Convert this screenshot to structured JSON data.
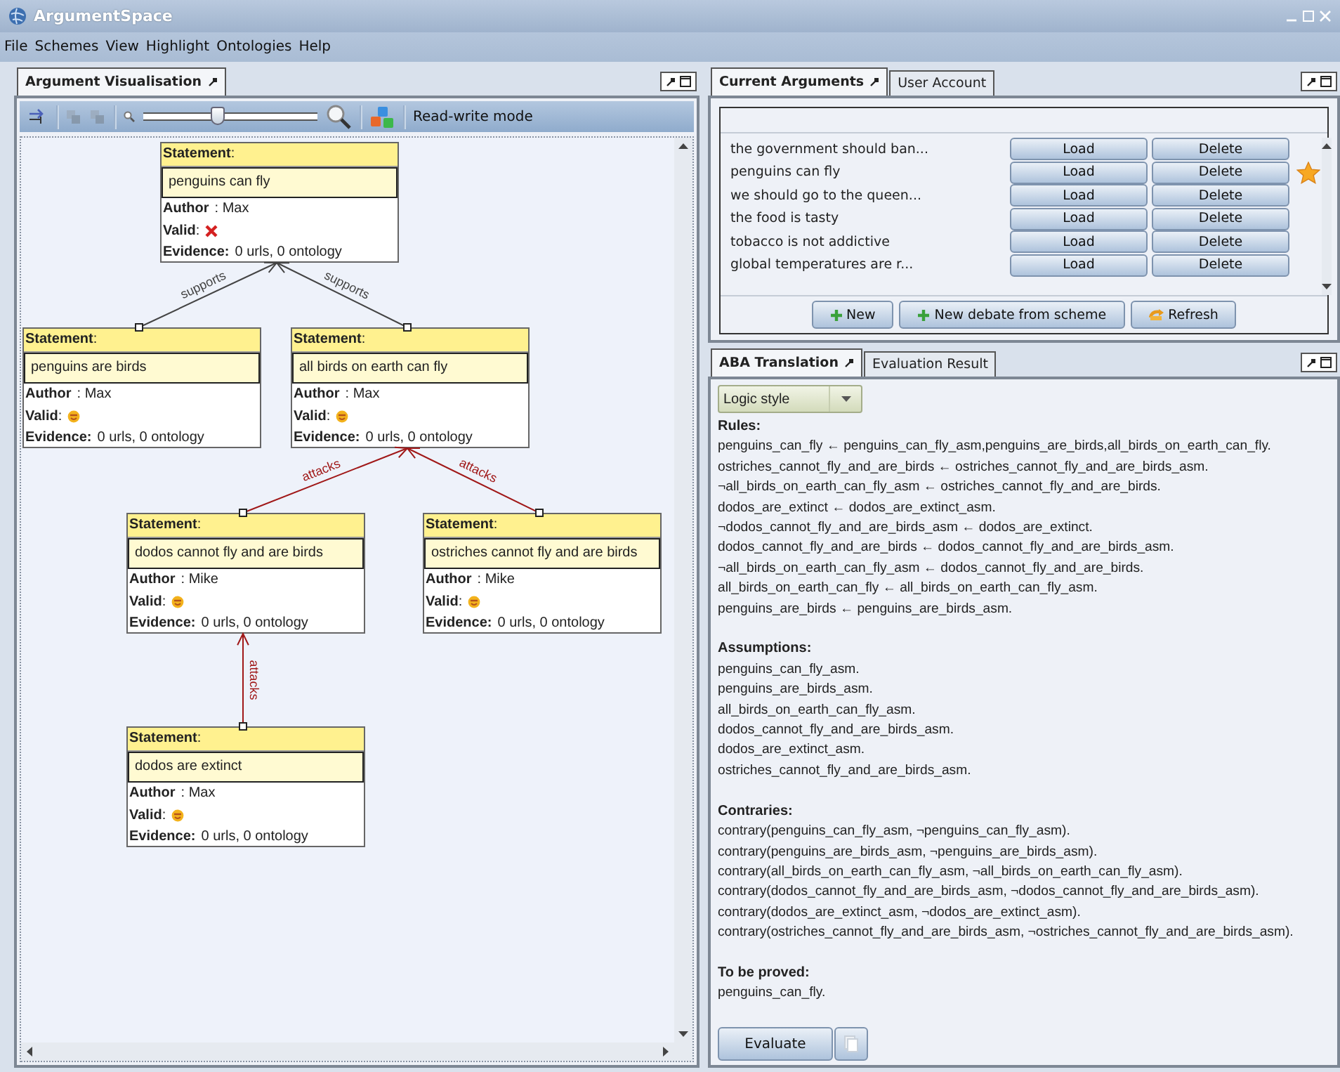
{
  "window": {
    "title": "ArgumentSpace"
  },
  "menu": [
    "File",
    "Schemes",
    "View",
    "Highlight",
    "Ontologies",
    "Help"
  ],
  "visualisation": {
    "tabs": [
      {
        "label": "Argument Visualisation",
        "selected": true
      }
    ],
    "toolbar": {
      "zoom": {
        "level": 0.43
      },
      "mode": "Read-write mode"
    },
    "argument": {
      "heading": "**Statement**:",
      "statement": "penguins can fly",
      "author": "**Author**: Max",
      "valid_label": "**Valid**:",
      "valid": false,
      "evidence": "**Evidence:** 0 urls, 0 ontology",
      "children": [
        {
          "relation": {
            "kind": "supports",
            "label": "supports"
          },
          "heading": "**Statement**:",
          "statement": "penguins are birds",
          "author": "**Author**: Max",
          "valid_label": "**Valid**:",
          "valid": true,
          "evidence": "**Evidence:** 0 urls, 0 ontology"
        },
        {
          "relation": {
            "kind": "supports",
            "label": "supports"
          },
          "heading": "**Statement**:",
          "statement": "all birds on earth can fly",
          "author": "**Author**: Max",
          "valid_label": "**Valid**:",
          "valid": true,
          "evidence": "**Evidence:** 0 urls, 0 ontology",
          "children": [
            {
              "relation": {
                "kind": "attacks",
                "label": "attacks"
              },
              "heading": "**Statement**:",
              "statement": "dodos cannot fly and are birds",
              "author": "**Author**: Mike",
              "valid_label": "**Valid**:",
              "valid": true,
              "evidence": "**Evidence:** 0 urls, 0 ontology",
              "children": [
                {
                  "relation": {
                    "kind": "attacks",
                    "label": "attacks"
                  },
                  "heading": "**Statement**:",
                  "statement": "dodos are extinct",
                  "author": "**Author**: Max",
                  "valid_label": "**Valid**:",
                  "valid": true,
                  "evidence": "**Evidence:** 0 urls, 0 ontology"
                }
              ]
            },
            {
              "relation": {
                "kind": "attacks",
                "label": "attacks"
              },
              "heading": "**Statement**:",
              "statement": "ostriches cannot fly and are birds",
              "author": "**Author**: Mike",
              "valid_label": "**Valid**:",
              "valid": true,
              "evidence": "**Evidence:** 0 urls, 0 ontology"
            }
          ]
        }
      ]
    }
  },
  "arguments": {
    "tabs": [
      {
        "label": "Current Arguments",
        "selected": true
      },
      {
        "label": "User Account",
        "selected": false
      }
    ],
    "rows": [
      {
        "title": "the government should ban...",
        "load": "Load",
        "delete": "Delete",
        "starred": false
      },
      {
        "title": "penguins can fly",
        "load": "Load",
        "delete": "Delete",
        "starred": true
      },
      {
        "title": "we should go to the queen...",
        "load": "Load",
        "delete": "Delete",
        "starred": false
      },
      {
        "title": "the food is tasty",
        "load": "Load",
        "delete": "Delete",
        "starred": false
      },
      {
        "title": "tobacco is not addictive",
        "load": "Load",
        "delete": "Delete",
        "starred": false
      },
      {
        "title": "global temperatures are r...",
        "load": "Load",
        "delete": "Delete",
        "starred": false
      }
    ],
    "actions": [
      {
        "label": "New",
        "kind": "add"
      },
      {
        "label": "New debate from scheme",
        "kind": "add"
      },
      {
        "label": "Refresh",
        "kind": "refresh"
      }
    ]
  },
  "aba": {
    "tabs": [
      {
        "label": "ABA Translation",
        "selected": true
      },
      {
        "label": "Evaluation Result",
        "selected": false
      }
    ],
    "style": "Logic style",
    "sections": [
      {
        "heading": "Rules:",
        "lines": [
          "penguins_can_fly ← penguins_can_fly_asm,penguins_are_birds,all_birds_on_earth_can_fly.",
          "ostriches_cannot_fly_and_are_birds ← ostriches_cannot_fly_and_are_birds_asm.",
          "¬all_birds_on_earth_can_fly_asm ← ostriches_cannot_fly_and_are_birds.",
          "dodos_are_extinct ← dodos_are_extinct_asm.",
          "¬dodos_cannot_fly_and_are_birds_asm ← dodos_are_extinct.",
          "dodos_cannot_fly_and_are_birds ← dodos_cannot_fly_and_are_birds_asm.",
          "¬all_birds_on_earth_can_fly_asm ← dodos_cannot_fly_and_are_birds.",
          "all_birds_on_earth_can_fly ← all_birds_on_earth_can_fly_asm.",
          "penguins_are_birds ← penguins_are_birds_asm."
        ]
      },
      {
        "heading": "Assumptions:",
        "lines": [
          "penguins_can_fly_asm.",
          "penguins_are_birds_asm.",
          "all_birds_on_earth_can_fly_asm.",
          "dodos_cannot_fly_and_are_birds_asm.",
          "dodos_are_extinct_asm.",
          "ostriches_cannot_fly_and_are_birds_asm."
        ]
      },
      {
        "heading": "Contraries:",
        "lines": [
          "contrary(penguins_can_fly_asm, ¬penguins_can_fly_asm).",
          "contrary(penguins_are_birds_asm, ¬penguins_are_birds_asm).",
          "contrary(all_birds_on_earth_can_fly_asm, ¬all_birds_on_earth_can_fly_asm).",
          "contrary(dodos_cannot_fly_and_are_birds_asm, ¬dodos_cannot_fly_and_are_birds_asm).",
          "contrary(dodos_are_extinct_asm, ¬dodos_are_extinct_asm).",
          "contrary(ostriches_cannot_fly_and_are_birds_asm, ¬ostriches_cannot_fly_and_are_birds_asm)."
        ]
      },
      {
        "heading": "To be proved:",
        "lines": [
          "penguins_can_fly."
        ]
      }
    ],
    "evaluate": "Evaluate"
  }
}
